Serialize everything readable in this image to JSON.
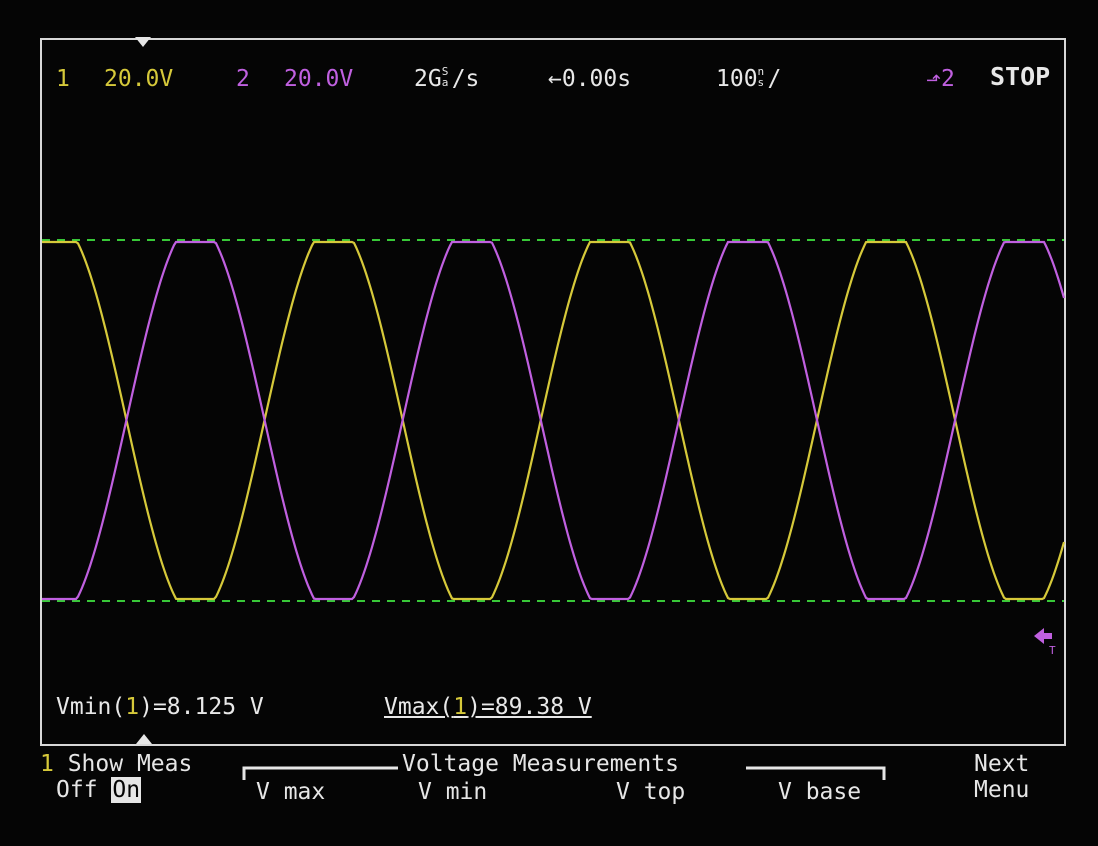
{
  "status_bar": {
    "ch1_num": "1",
    "ch1_scale": "20.0V",
    "ch2_num": "2",
    "ch2_scale": "20.0V",
    "sample_rate_prefix": "2G",
    "sample_rate_unit": "/s",
    "delay_arrow": "←",
    "delay": "0.00s",
    "timebase_value": "100",
    "timebase_unit": "/",
    "trigger_source": "2",
    "run_state": "STOP"
  },
  "measurements": {
    "vmin_prefix": "Vmin(",
    "vmin_ch": "1",
    "vmin_suffix": ")=8.125 V",
    "vmax_prefix": "Vmax(",
    "vmax_ch": "1",
    "vmax_suffix": ")=89.38 V"
  },
  "softkeys": {
    "show_meas_ch": "1",
    "show_meas_label": " Show Meas",
    "off_label": "Off",
    "on_label": "On",
    "group_title": "Voltage Measurements",
    "vmax_label": "V max",
    "vmin_label": "V min",
    "vtop_label": "V top",
    "vbase_label": "V base",
    "next_line1": "Next",
    "next_line2": "Menu"
  },
  "colors": {
    "ch1": "#d6c93a",
    "ch2": "#c060e0",
    "marker_lines": "#38c838",
    "grid_text": "#e8e8e8",
    "trigger_marker": "#c060e0"
  },
  "waveform": {
    "ch1_cycles_visible": 3.7,
    "ch2_phase_shift_deg": 180,
    "shape": "clipped-sine"
  }
}
